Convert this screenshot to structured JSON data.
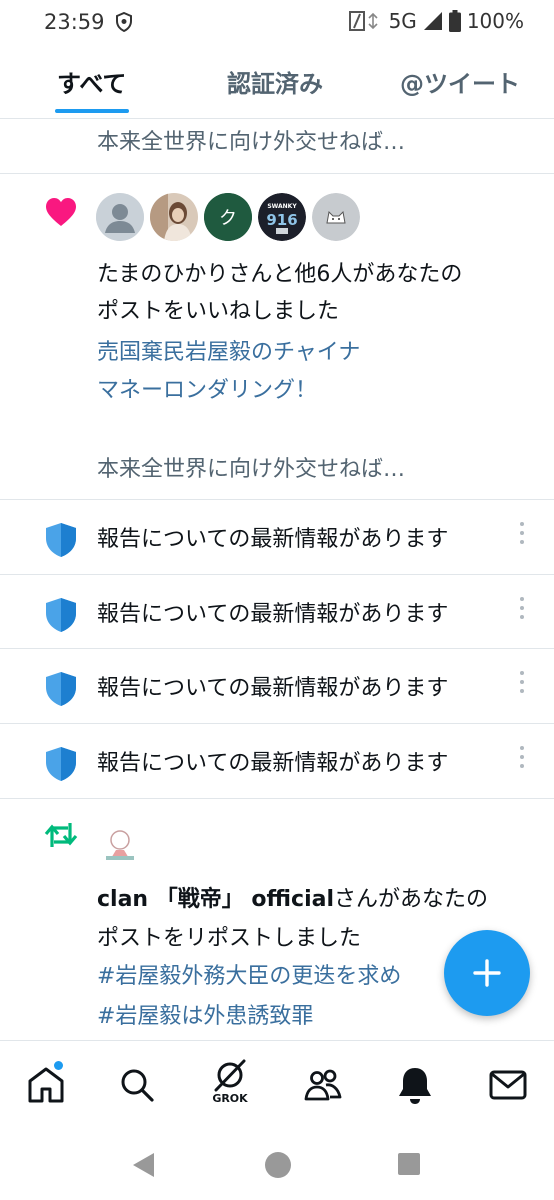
{
  "status_bar": {
    "time": "23:59",
    "network": "5G",
    "battery": "100%",
    "icons": [
      "shield-icon",
      "data-saver-icon",
      "signal-icon",
      "battery-icon"
    ]
  },
  "tabs": [
    {
      "label": "すべて",
      "active": true
    },
    {
      "label": "認証済み",
      "active": false
    },
    {
      "label": "@ツイート",
      "active": false
    }
  ],
  "top_snippet": "本来全世界に向け外交せねば…",
  "like_notification": {
    "icon": "heart-icon",
    "text_line1": "たまのひかりさんと他6人があなたの",
    "text_line2": "ポストをいいねしました",
    "post_line1": "売国棄民岩屋毅のチャイナ",
    "post_line2": "マネーロンダリング！",
    "post_line3": "本来全世界に向け外交せねば…",
    "avatars": [
      {
        "name": "default-avatar"
      },
      {
        "name": "photo-avatar"
      },
      {
        "name": "letter-avatar",
        "letter": "ク"
      },
      {
        "name": "team-avatar",
        "text_top": "SWANKY",
        "text_mid": "916"
      },
      {
        "name": "cat-avatar"
      }
    ]
  },
  "reports": [
    {
      "text": "報告についての最新情報があります"
    },
    {
      "text": "報告についての最新情報があります"
    },
    {
      "text": "報告についての最新情報があります"
    },
    {
      "text": "報告についての最新情報があります"
    }
  ],
  "repost_notification": {
    "icon": "repost-icon",
    "account_bold": "clan 「戦帝」 official",
    "text_rest": "さんがあなたの",
    "text_line2": "ポストをリポストしました",
    "hashtag1": "#岩屋毅外務大臣の更迭を求め",
    "hashtag2": "#岩屋毅は外患誘致罪"
  },
  "fab": {
    "icon": "plus-icon"
  },
  "bottom_nav": [
    {
      "name": "home-icon"
    },
    {
      "name": "search-icon"
    },
    {
      "name": "grok-icon",
      "label": "GROK"
    },
    {
      "name": "communities-icon"
    },
    {
      "name": "notifications-icon"
    },
    {
      "name": "messages-icon"
    }
  ],
  "colors": {
    "accent": "#1d9bf0",
    "like": "#f91880",
    "repost": "#00ba7c",
    "link": "#3a6f9e"
  }
}
